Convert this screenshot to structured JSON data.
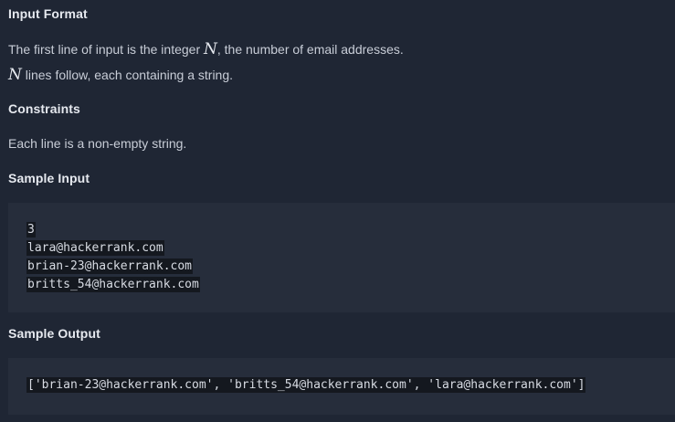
{
  "sections": {
    "input_format": {
      "heading": "Input Format",
      "line1_pre": "The first line of input is the integer ",
      "line1_var": "N",
      "line1_post": ", the number of email addresses.",
      "line2_var": "N",
      "line2_post": " lines follow, each containing a string."
    },
    "constraints": {
      "heading": "Constraints",
      "text": "Each line is a non-empty string."
    },
    "sample_input": {
      "heading": "Sample Input",
      "lines": [
        "3",
        "lara@hackerrank.com",
        "brian-23@hackerrank.com",
        "britts_54@hackerrank.com"
      ]
    },
    "sample_output": {
      "heading": "Sample Output",
      "line": "['brian-23@hackerrank.com', 'britts_54@hackerrank.com', 'lara@hackerrank.com']"
    }
  },
  "colors": {
    "background": "#1f2634",
    "code_background": "#262d3b",
    "code_highlight": "#14181f"
  }
}
